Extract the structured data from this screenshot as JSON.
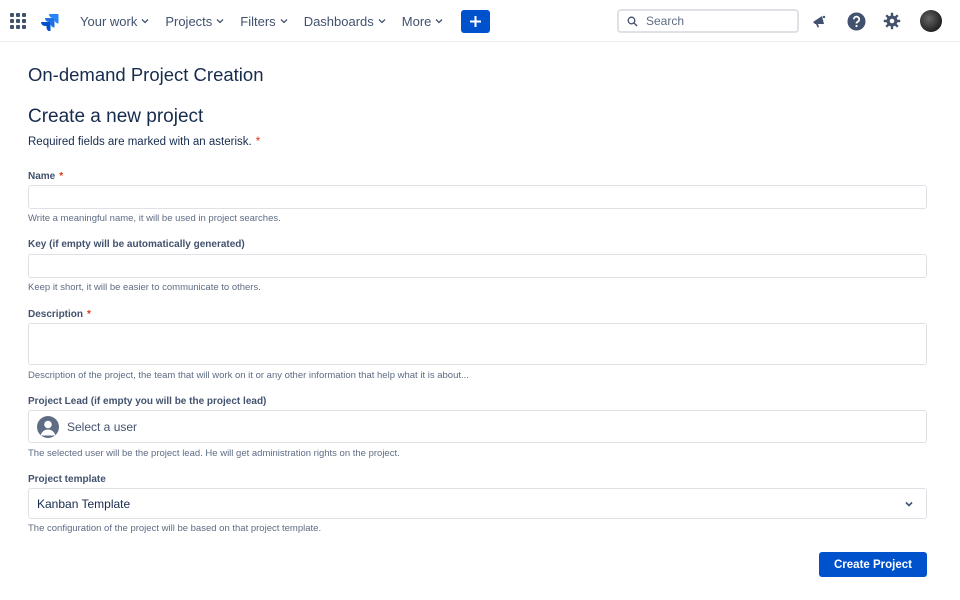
{
  "nav": {
    "menu": [
      {
        "label": "Your work"
      },
      {
        "label": "Projects"
      },
      {
        "label": "Filters"
      },
      {
        "label": "Dashboards"
      },
      {
        "label": "More"
      }
    ],
    "search_placeholder": "Search",
    "accent_color": "#0052cc"
  },
  "page": {
    "title": "On-demand Project Creation",
    "section_title": "Create a new project",
    "required_note": "Required fields are marked with an asterisk.",
    "asterisk": "*"
  },
  "form": {
    "name": {
      "label": "Name",
      "value": "",
      "help": "Write a meaningful name, it will be used in project searches."
    },
    "key": {
      "label": "Key (if empty will be automatically generated)",
      "value": "",
      "help": "Keep it short, it will be easier to communicate to others."
    },
    "description": {
      "label": "Description",
      "value": "",
      "help": "Description of the project, the team that will work on it or any other information that help what it is about..."
    },
    "lead": {
      "label": "Project Lead (if empty you will be the project lead)",
      "placeholder": "Select a user",
      "help": "The selected user will be the project lead. He will get administration rights on the project."
    },
    "template": {
      "label": "Project template",
      "value": "Kanban Template",
      "help": "The configuration of the project will be based on that project template."
    },
    "submit_label": "Create Project"
  }
}
